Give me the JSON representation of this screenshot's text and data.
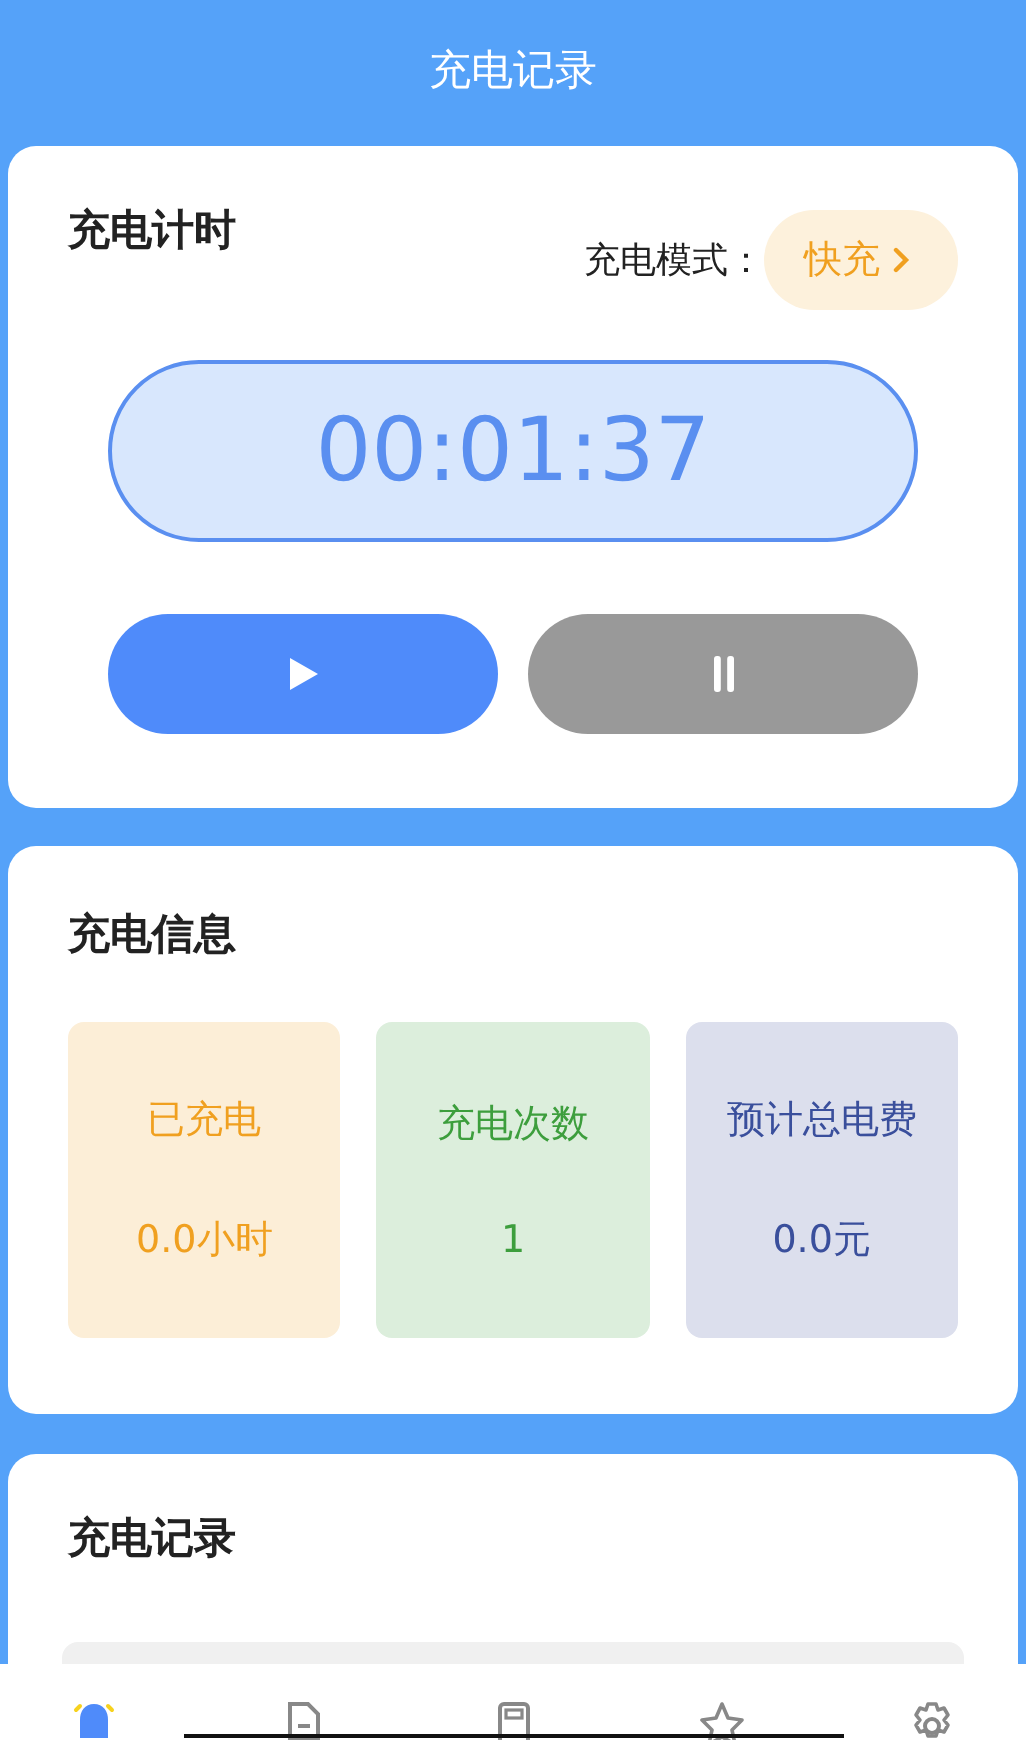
{
  "header": {
    "title": "充电记录"
  },
  "timer_card": {
    "title": "充电计时",
    "mode_label": "充电模式：",
    "mode": "快充",
    "time": "00:01:37",
    "controls": [
      {
        "kind": "play",
        "disabled": false
      },
      {
        "kind": "pause",
        "disabled": true
      }
    ]
  },
  "info_card": {
    "title": "充电信息",
    "stats": [
      {
        "label": "已充电",
        "value": "0.0小时",
        "color": "#f0a020"
      },
      {
        "label": "充电次数",
        "value": "1",
        "color": "#3d9e3d"
      },
      {
        "label": "预计总电费",
        "value": "0.0元",
        "color": "#3a4f9c"
      }
    ]
  },
  "records_card": {
    "title": "充电记录"
  },
  "nav": [
    {
      "kind": "bell",
      "selected": true
    },
    {
      "kind": "document",
      "selected": false
    },
    {
      "kind": "charger",
      "selected": false
    },
    {
      "kind": "star",
      "selected": false
    },
    {
      "kind": "settings",
      "selected": false
    }
  ]
}
